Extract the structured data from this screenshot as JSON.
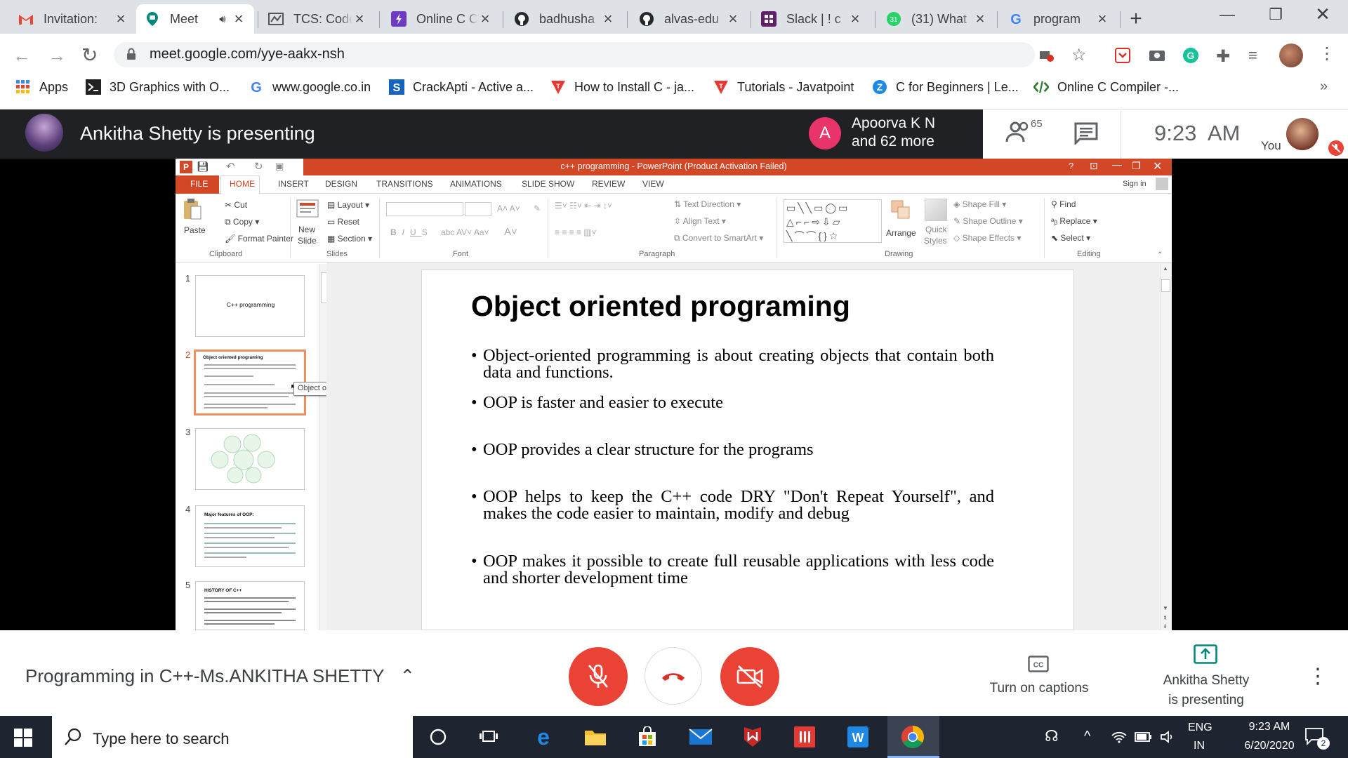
{
  "browser": {
    "tabs": [
      {
        "title": "Invitation:",
        "icon": "gmail-icon"
      },
      {
        "title": "Meet",
        "icon": "meet-icon",
        "active": true
      },
      {
        "title": "TCS: Code",
        "icon": "tcs-icon"
      },
      {
        "title": "Online C C",
        "icon": "compiler-icon"
      },
      {
        "title": "badhusha",
        "icon": "github-icon"
      },
      {
        "title": "alvas-edu",
        "icon": "github-icon"
      },
      {
        "title": "Slack | ! c",
        "icon": "slack-icon"
      },
      {
        "title": "(31) What",
        "icon": "whatsapp-icon"
      },
      {
        "title": "program",
        "icon": "google-icon"
      }
    ],
    "url": "meet.google.com/yye-aakx-nsh",
    "bookmarks": [
      {
        "label": "Apps",
        "icon": "apps-grid-icon"
      },
      {
        "label": "3D Graphics with O...",
        "icon": "terminal-icon"
      },
      {
        "label": "www.google.co.in",
        "icon": "google-icon"
      },
      {
        "label": "CrackApti - Active a...",
        "icon": "crackapti-icon"
      },
      {
        "label": "How to Install C - ja...",
        "icon": "javatpoint-icon"
      },
      {
        "label": "Tutorials - Javatpoint",
        "icon": "javatpoint-icon"
      },
      {
        "label": "C for Beginners | Le...",
        "icon": "c-course-icon"
      },
      {
        "label": "Online C Compiler -...",
        "icon": "code-icon"
      }
    ],
    "bookmarks_more": "»"
  },
  "meet": {
    "presenting_title": "Ankitha Shetty is presenting",
    "participant_initial": "A",
    "participant_line1": "Apoorva K N",
    "participant_line2": "and 62 more",
    "participant_count": "65",
    "time": "9:23  AM",
    "self_label": "You",
    "meeting_name": "Programming in C++-Ms.ANKITHA SHETTY",
    "captions_label": "Turn on captions",
    "presenting_line1": "Ankitha Shetty",
    "presenting_line2": "is presenting",
    "colors": {
      "red_button": "#ea4335",
      "meet_bar": "#202124"
    }
  },
  "powerpoint": {
    "title": "c++ programming - PowerPoint (Product Activation Failed)",
    "menu_tabs": [
      "FILE",
      "HOME",
      "INSERT",
      "DESIGN",
      "TRANSITIONS",
      "ANIMATIONS",
      "SLIDE SHOW",
      "REVIEW",
      "VIEW"
    ],
    "sign_in": "Sign in",
    "ribbon": {
      "cut": "Cut",
      "copy": "Copy",
      "format_painter": "Format Painter",
      "paste": "Paste",
      "layout": "Layout",
      "reset": "Reset",
      "section": "Section",
      "new_slide_1": "New",
      "new_slide_2": "Slide",
      "text_direction": "Text Direction",
      "align_text": "Align Text",
      "convert_smartart": "Convert to SmartArt",
      "arrange": "Arrange",
      "quick_styles_1": "Quick",
      "quick_styles_2": "Styles",
      "shape_fill": "Shape Fill",
      "shape_outline": "Shape Outline",
      "shape_effects": "Shape Effects",
      "find": "Find",
      "replace": "Replace",
      "select": "Select",
      "groups": [
        "Clipboard",
        "Slides",
        "Font",
        "Paragraph",
        "Drawing",
        "Editing"
      ]
    },
    "thumbnails": [
      {
        "num": "1",
        "title": "C++ programming"
      },
      {
        "num": "2",
        "title": "Object oriented programing",
        "selected": true
      },
      {
        "num": "3",
        "title": ""
      },
      {
        "num": "4",
        "title": "Major features of OOP:"
      },
      {
        "num": "5",
        "title": "HISTORY OF C++"
      }
    ],
    "tooltip": "Object oriented programing",
    "slide": {
      "title": "Object oriented programing",
      "bullets": [
        "Object-oriented programming is about creating objects that contain both data and functions.",
        "OOP is faster and easier to execute",
        "OOP provides a clear structure for the programs",
        "OOP helps to keep the C++ code DRY \"Don't Repeat Yourself\", and makes the code easier to maintain, modify and debug",
        "OOP makes it possible to create full reusable applications with less code and shorter development time"
      ]
    },
    "colors": {
      "title_bar": "#d24726",
      "accent": "#d24726"
    }
  },
  "taskbar": {
    "search_placeholder": "Type here to search",
    "lang_line1": "ENG",
    "lang_line2": "IN",
    "clock_time": "9:23 AM",
    "clock_date": "6/20/2020",
    "notification_count": "2"
  }
}
